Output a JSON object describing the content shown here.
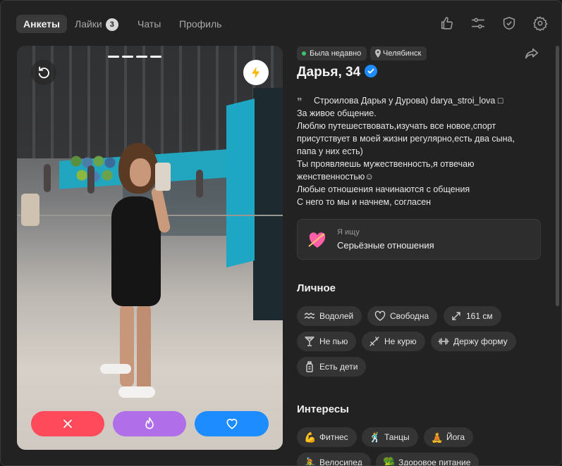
{
  "tabs": [
    {
      "label": "Анкеты"
    },
    {
      "label": "Лайки",
      "badge": "3"
    },
    {
      "label": "Чаты"
    },
    {
      "label": "Профиль"
    }
  ],
  "profile": {
    "status": "Была недавно",
    "city": "Челябинск",
    "name": "Дарья, 34",
    "bio_lines": [
      "Строилова Дарья у Дурова) darya_stroi_lova □",
      "За живое общение.",
      "Люблю путешествовать,изучать все новое,спорт",
      "присутствует в моей жизни регулярно,есть два сына,",
      "папа у них есть)",
      "Ты проявляешь мужественность,я отвечаю",
      "женственностью☺",
      "Любые отношения начинаются с общения",
      "С него то мы и начнем, согласен"
    ],
    "seeking_label": "Я ищу",
    "seeking_value": "Серьёзные отношения"
  },
  "sections": {
    "personal_title": "Личное",
    "interests_title": "Интересы"
  },
  "personal": [
    {
      "label": "Водолей",
      "icon": "aquarius-icon"
    },
    {
      "label": "Свободна",
      "icon": "heart-outline-icon"
    },
    {
      "label": "161 см",
      "icon": "height-arrows-icon"
    },
    {
      "label": "Не пью",
      "icon": "glass-icon"
    },
    {
      "label": "Не курю",
      "icon": "no-smoking-icon"
    },
    {
      "label": "Держу форму",
      "icon": "dumbbell-icon"
    },
    {
      "label": "Есть дети",
      "icon": "baby-bottle-icon"
    }
  ],
  "interests": [
    {
      "label": "Фитнес",
      "emoji": "💪"
    },
    {
      "label": "Танцы",
      "emoji": "🕺"
    },
    {
      "label": "Йога",
      "emoji": "🧘"
    },
    {
      "label": "Велосипед",
      "emoji": "🚴"
    },
    {
      "label": "Здоровое питание",
      "emoji": "🥦"
    }
  ],
  "colors": {
    "dislike": "#ff4a5b",
    "superlike": "#b06ee8",
    "like": "#1c8cff",
    "online": "#3fc26a"
  }
}
